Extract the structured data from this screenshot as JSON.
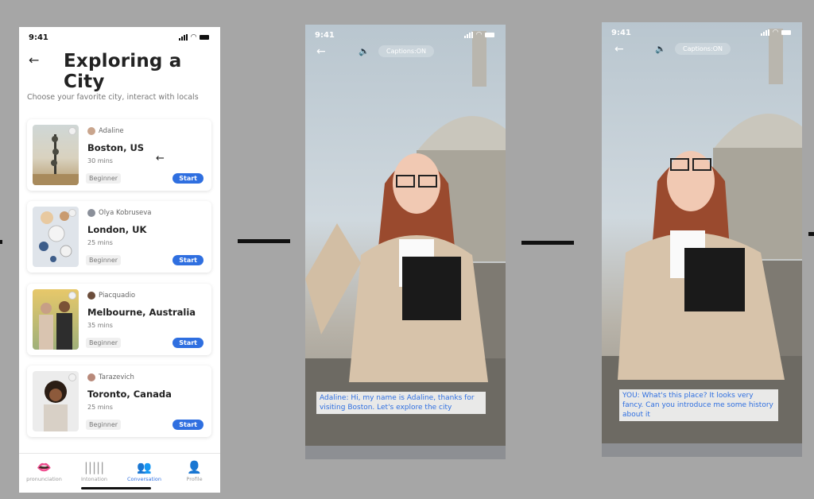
{
  "screen1": {
    "status_time": "9:41",
    "title": "Exploring a City",
    "subtitle": "Choose your favorite city, interact with locals",
    "cards": [
      {
        "tutor": "Adaline",
        "city": "Boston, US",
        "duration": "30 mins",
        "level": "Beginner",
        "button": "Start"
      },
      {
        "tutor": "Olya Kobruseva",
        "city": "London, UK",
        "duration": "25 mins",
        "level": "Beginner",
        "button": "Start"
      },
      {
        "tutor": "Piacquadio",
        "city": "Melbourne, Australia",
        "duration": "35 mins",
        "level": "Beginner",
        "button": "Start"
      },
      {
        "tutor": "Tarazevich",
        "city": "Toronto, Canada",
        "duration": "25 mins",
        "level": "Beginner",
        "button": "Start"
      }
    ],
    "tabs": [
      {
        "label": "pronunciation",
        "icon": "lips-icon"
      },
      {
        "label": "Intonation",
        "icon": "waveform-icon"
      },
      {
        "label": "Conversation",
        "icon": "chat-people-icon"
      },
      {
        "label": "Profile",
        "icon": "person-icon"
      }
    ],
    "accent_color": "#2f6fe0"
  },
  "screen2": {
    "status_time": "9:41",
    "captions_label": "Captions:ON",
    "caption_text": "Adaline: Hi, my name is Adaline, thanks for visiting Boston. Let's explore the city"
  },
  "screen3": {
    "status_time": "9:41",
    "captions_label": "Captions:ON",
    "caption_text": "YOU: What's this place? It looks very fancy. Can you introduce me some history about it"
  }
}
